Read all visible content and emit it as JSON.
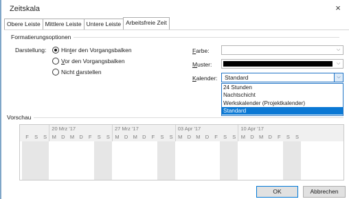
{
  "dialog": {
    "title": "Zeitskala",
    "close_glyph": "×"
  },
  "tabs": [
    {
      "label": "Obere Leiste"
    },
    {
      "label": "Mittlere Leiste"
    },
    {
      "label": "Untere Leiste"
    },
    {
      "label": "Arbeitsfreie Zeit",
      "active": true
    }
  ],
  "formatting": {
    "section_title": "Formatierungsoptionen",
    "darstellung_label": "Darstellung:",
    "radio_options": [
      {
        "pre": "Hin",
        "key": "t",
        "post": "er den Vorgangsbalken",
        "checked": true
      },
      {
        "pre": "",
        "key": "V",
        "post": "or den Vorgangsbalken",
        "checked": false
      },
      {
        "pre": "Nicht ",
        "key": "d",
        "post": "arstellen",
        "checked": false
      }
    ],
    "farbe": {
      "key": "F",
      "rest": "arbe:",
      "value": ""
    },
    "muster": {
      "key": "M",
      "rest": "uster:",
      "swatch_color": "#000000"
    },
    "kalender": {
      "key": "K",
      "rest": "alender:",
      "value": "Standard",
      "options": [
        "24 Stunden",
        "Nachtschicht",
        "Werkskalender (Projektkalender)",
        "Standard"
      ],
      "selected_index": 3
    },
    "dropdown_arrow": "⌵"
  },
  "preview": {
    "section_title": "Vorschau",
    "weeks": [
      "20 Mrz '17",
      "27 Mrz '17",
      "03 Apr '17",
      "10 Apr '17"
    ],
    "lead_days": [
      "F",
      "S",
      "S"
    ],
    "days": [
      "M",
      "D",
      "M",
      "D",
      "F",
      "S",
      "S"
    ],
    "nonworking_shade": "#e6e6e6"
  },
  "buttons": {
    "ok": "OK",
    "cancel": "Abbrechen"
  },
  "colors": {
    "accent": "#0a78d4",
    "selection_text": "#ffffff"
  }
}
